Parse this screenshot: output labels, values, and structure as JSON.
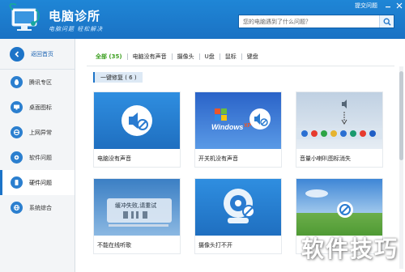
{
  "header": {
    "title": "电脑诊所",
    "subtitle": "电脑问题 轻松解决",
    "top_link": "提交问题",
    "search": {
      "placeholder": "您的电脑遇到了什么问题？"
    }
  },
  "sidebar": {
    "back_label": "返回首页",
    "items": [
      {
        "label": "腾讯专区",
        "icon": "penguin-icon"
      },
      {
        "label": "桌面图标",
        "icon": "monitor-icon"
      },
      {
        "label": "上网异常",
        "icon": "internet-explorer-icon"
      },
      {
        "label": "软件问题",
        "icon": "software-icon"
      },
      {
        "label": "硬件问题",
        "icon": "phone-hardware-icon",
        "active": true
      },
      {
        "label": "系统综合",
        "icon": "globe-icon"
      }
    ]
  },
  "main": {
    "tabs": [
      {
        "label": "全部 (35)",
        "active": true
      },
      {
        "label": "电脑没有声音"
      },
      {
        "label": "摄像头"
      },
      {
        "label": "U盘"
      },
      {
        "label": "鼠标"
      },
      {
        "label": "键盘"
      }
    ],
    "section": "一键修复 ( 6 )",
    "cards": [
      {
        "label": "电脑没有声音",
        "image": "mute-speaker"
      },
      {
        "label": "开关机没有声音",
        "image": "windows-xp-mute"
      },
      {
        "label": "音量小喇叭图标消失",
        "image": "tray-volume"
      },
      {
        "label": "不能在线听歌",
        "image": "music-player",
        "player_text": "缓冲失败,请重试"
      },
      {
        "label": "摄像头打不开",
        "image": "webcam"
      },
      {
        "label": "",
        "image": "desktop-landscape"
      }
    ]
  },
  "watermark": "软件技巧",
  "colors": {
    "header": "#1a72c4",
    "accent": "#1d74c8",
    "active_tab": "#3b9f1f"
  }
}
